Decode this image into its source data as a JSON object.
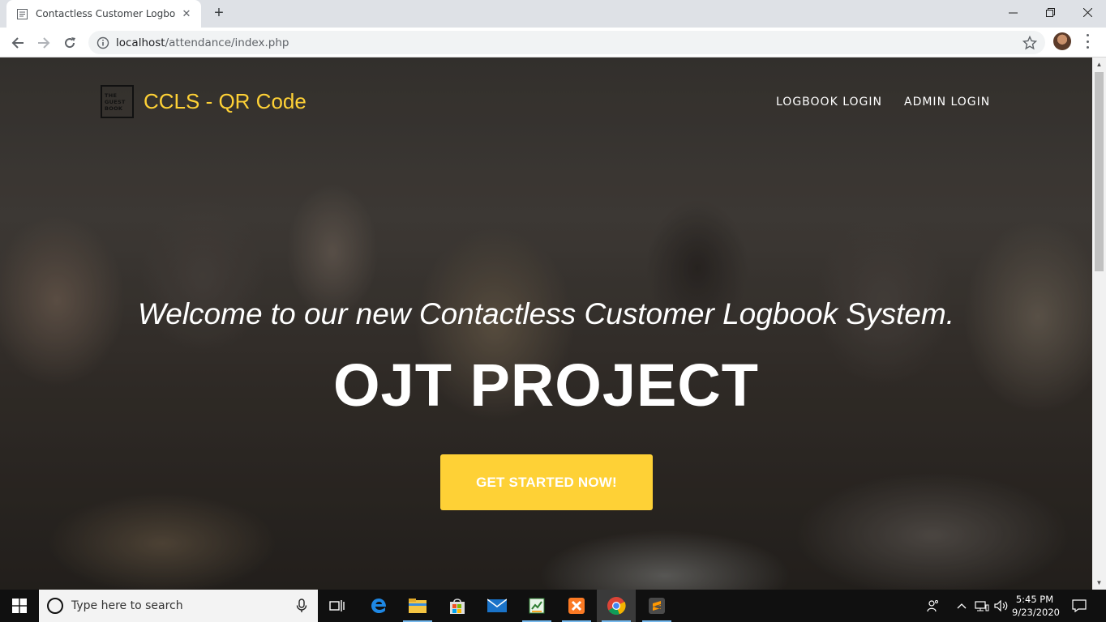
{
  "browser": {
    "tab_title": "Contactless Customer Logbook S",
    "tab_close": "✕",
    "new_tab": "+",
    "url_host": "localhost",
    "url_path": "/attendance/index.php",
    "window_controls": {
      "minimize": "—",
      "maximize": "❐",
      "close": "✕"
    }
  },
  "site": {
    "logo_lines": [
      "THE",
      "GUEST",
      "BOOK"
    ],
    "brand": "CCLS - QR Code",
    "nav": [
      "LOGBOOK LOGIN",
      "ADMIN LOGIN"
    ],
    "subheading": "Welcome to our new Contactless Customer Logbook System.",
    "heading": "OJT PROJECT",
    "cta": "GET STARTED NOW!",
    "accent_color": "#fed136"
  },
  "taskbar": {
    "search_placeholder": "Type here to search",
    "apps": [
      "task-view-icon",
      "edge-icon",
      "file-explorer-icon",
      "store-icon",
      "mail-icon",
      "excel-app-icon",
      "xampp-icon",
      "chrome-icon",
      "sublime-text-icon"
    ],
    "active_app": "chrome-icon",
    "time": "5:45 PM",
    "date": "9/23/2020"
  }
}
